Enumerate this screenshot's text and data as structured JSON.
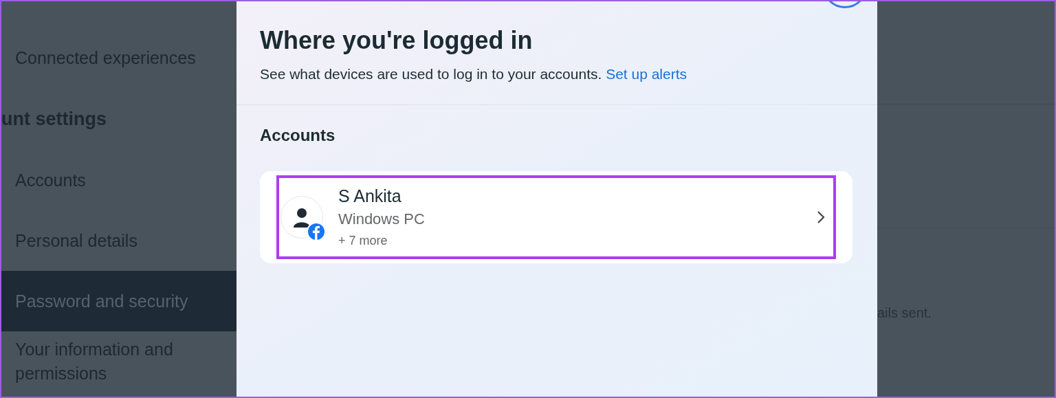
{
  "sidebar": {
    "items": [
      {
        "kind": "item",
        "label": "Connected experiences",
        "selected": false
      },
      {
        "kind": "heading",
        "label": "unt settings"
      },
      {
        "kind": "item",
        "label": "Accounts",
        "selected": false
      },
      {
        "kind": "item",
        "label": "Personal details",
        "selected": false
      },
      {
        "kind": "item",
        "label": "Password and security",
        "selected": true
      },
      {
        "kind": "item",
        "label": "Your information and permissions",
        "selected": false
      }
    ]
  },
  "background_text": "ails sent.",
  "dialog": {
    "title": "Where you're logged in",
    "description": "See what devices are used to log in to your accounts.",
    "link": "Set up alerts",
    "section": "Accounts",
    "accounts": [
      {
        "name": "S Ankita",
        "device": "Windows PC",
        "more": "+ 7 more",
        "highlighted": true
      }
    ]
  }
}
